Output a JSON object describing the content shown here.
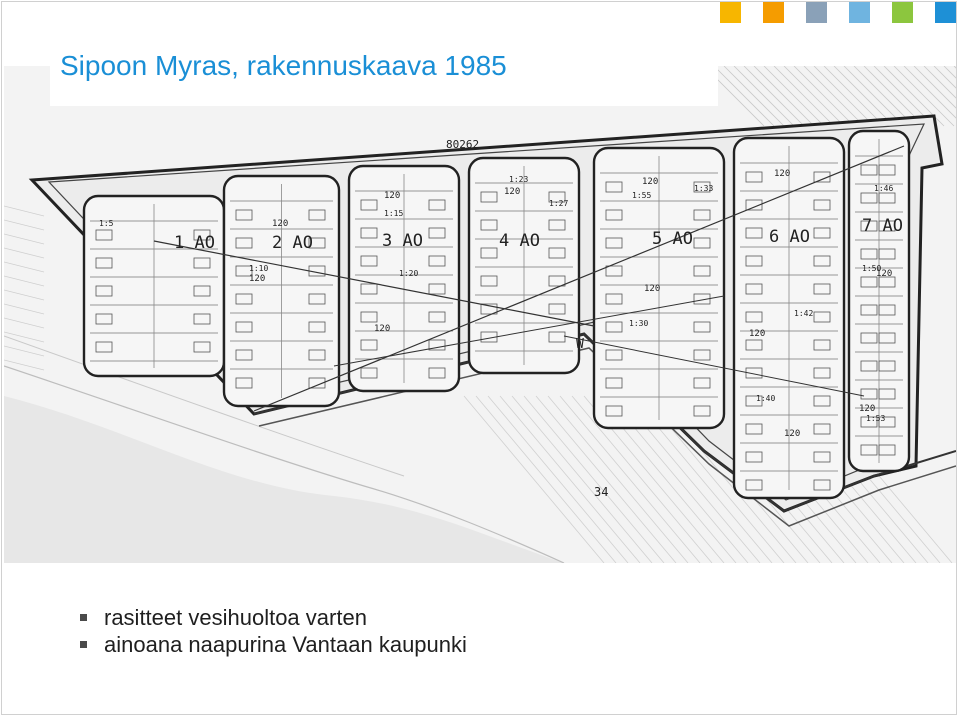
{
  "slide": {
    "title": "Sipoon Myras, rakennuskaava 1985",
    "accent_squares": [
      "#f7b600",
      "#f59c00",
      "#8aa1b8",
      "#6fb4e0",
      "#8cc63e",
      "#1e90d6"
    ],
    "bullets": [
      {
        "text": "rasitteet vesihuoltoa varten"
      },
      {
        "text": "ainoana naapurina Vantaan kaupunki"
      }
    ]
  },
  "map": {
    "type": "grayscale zoning plan drawing",
    "block_labels": [
      "1 AO",
      "2 AO",
      "3 AO",
      "4 AO",
      "5 AO",
      "6 AO",
      "7 AO"
    ],
    "road_label": "80262",
    "misc_labels": [
      "34",
      "W"
    ],
    "plot_labels": [
      "120",
      "120",
      "120",
      "120",
      "120",
      "120",
      "120",
      "120",
      "120",
      "120",
      "120",
      "120"
    ],
    "ratio_labels": [
      "1:5",
      "1:10",
      "1:15",
      "1:20",
      "1:23",
      "1:27",
      "1:30",
      "1:33",
      "1:40",
      "1:42",
      "1:50",
      "1:53",
      "1:55",
      "1:46"
    ]
  }
}
